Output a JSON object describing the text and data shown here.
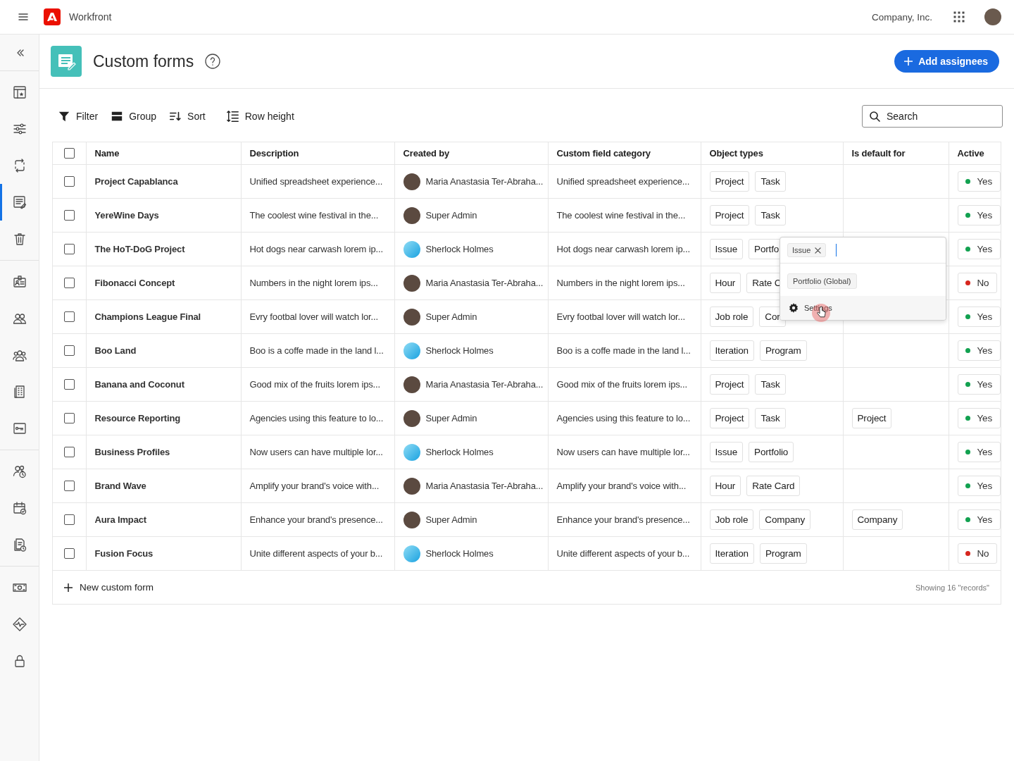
{
  "topbar": {
    "app_name": "Workfront",
    "company": "Company, Inc."
  },
  "sidebar": {
    "groups": [
      [
        {
          "kind": "layout",
          "selected": false
        },
        {
          "kind": "sliders",
          "selected": false
        },
        {
          "kind": "swap",
          "selected": false
        },
        {
          "kind": "form",
          "selected": true
        },
        {
          "kind": "trash",
          "selected": false
        }
      ],
      [
        {
          "kind": "badge",
          "selected": false
        },
        {
          "kind": "pair",
          "selected": false
        },
        {
          "kind": "team",
          "selected": false
        },
        {
          "kind": "building",
          "selected": false
        },
        {
          "kind": "key",
          "selected": false
        }
      ],
      [
        {
          "kind": "userclock",
          "selected": false
        },
        {
          "kind": "calendar",
          "selected": false
        },
        {
          "kind": "docclock",
          "selected": false
        }
      ],
      [
        {
          "kind": "money",
          "selected": false
        },
        {
          "kind": "pulse",
          "selected": false
        },
        {
          "kind": "lock",
          "selected": false
        }
      ]
    ]
  },
  "page": {
    "title": "Custom forms",
    "primary_button": "Add assignees"
  },
  "toolbar": {
    "actions": [
      {
        "kind": "filter",
        "label": "Filter"
      },
      {
        "kind": "group",
        "label": "Group"
      },
      {
        "kind": "sort",
        "label": "Sort"
      },
      {
        "kind": "rowheight",
        "label": "Row height"
      }
    ],
    "search": {
      "placeholder": "Search"
    }
  },
  "table": {
    "select_all": {
      "checked": false
    },
    "columns": [
      "Name",
      "Description",
      "Created by",
      "Custom field category",
      "Object types",
      "Is default for",
      "Active"
    ],
    "rows": [
      {
        "checked": false,
        "name": "Project Capablanca",
        "description": "Unified spreadsheet experience...",
        "created_by": {
          "name": "Maria Anastasia Ter-Abraha...",
          "kind": "photo"
        },
        "category": "Unified spreadsheet experience...",
        "object_types": [
          "Project",
          "Task"
        ],
        "default_for": [],
        "active": {
          "label": "Yes",
          "color": "#12a150"
        }
      },
      {
        "checked": false,
        "name": "YereWine Days",
        "description": "The coolest wine festival in the...",
        "created_by": {
          "name": "Super Admin",
          "kind": "photo"
        },
        "category": "The coolest wine festival in the...",
        "object_types": [
          "Project",
          "Task"
        ],
        "default_for": [],
        "active": {
          "label": "Yes",
          "color": "#12a150"
        }
      },
      {
        "checked": false,
        "name": "The HoT-DoG Project",
        "description": "Hot dogs near carwash lorem ip...",
        "created_by": {
          "name": "Sherlock Holmes",
          "kind": "gradient"
        },
        "category": "Hot dogs near carwash lorem ip...",
        "object_types": [
          "Issue",
          "Portfo"
        ],
        "default_for": [],
        "active": {
          "label": "Yes",
          "color": "#12a150"
        }
      },
      {
        "checked": false,
        "name": "Fibonacci Concept",
        "description": "Numbers in the night lorem ips...",
        "created_by": {
          "name": "Maria Anastasia Ter-Abraha...",
          "kind": "photo"
        },
        "category": "Numbers in the night lorem ips...",
        "object_types": [
          "Hour",
          "Rate C"
        ],
        "default_for": [],
        "active": {
          "label": "No",
          "color": "#d7261e"
        }
      },
      {
        "checked": false,
        "name": "Champions League Final",
        "description": "Evry footbal lover will watch lor...",
        "created_by": {
          "name": "Super Admin",
          "kind": "photo"
        },
        "category": "Evry footbal lover will watch lor...",
        "object_types": [
          "Job role",
          "Cor"
        ],
        "default_for": [],
        "active": {
          "label": "Yes",
          "color": "#12a150"
        }
      },
      {
        "checked": false,
        "name": "Boo Land",
        "description": "Boo is a coffe made in the land l...",
        "created_by": {
          "name": "Sherlock Holmes",
          "kind": "gradient"
        },
        "category": "Boo is a coffe made in the land l...",
        "object_types": [
          "Iteration",
          "Program"
        ],
        "default_for": [],
        "active": {
          "label": "Yes",
          "color": "#12a150"
        }
      },
      {
        "checked": false,
        "name": "Banana and Coconut",
        "description": "Good mix of the fruits lorem ips...",
        "created_by": {
          "name": "Maria Anastasia Ter-Abraha...",
          "kind": "photo"
        },
        "category": "Good mix of the fruits lorem ips...",
        "object_types": [
          "Project",
          "Task"
        ],
        "default_for": [],
        "active": {
          "label": "Yes",
          "color": "#12a150"
        }
      },
      {
        "checked": false,
        "name": "Resource Reporting",
        "description": "Agencies using this feature to lo...",
        "created_by": {
          "name": "Super Admin",
          "kind": "photo"
        },
        "category": "Agencies using this feature to lo...",
        "object_types": [
          "Project",
          "Task"
        ],
        "default_for": [
          "Project"
        ],
        "active": {
          "label": "Yes",
          "color": "#12a150"
        }
      },
      {
        "checked": false,
        "name": "Business Profiles",
        "description": "Now users can have multiple lor...",
        "created_by": {
          "name": "Sherlock Holmes",
          "kind": "gradient"
        },
        "category": "Now users can have multiple lor...",
        "object_types": [
          "Issue",
          "Portfolio"
        ],
        "default_for": [],
        "active": {
          "label": "Yes",
          "color": "#12a150"
        }
      },
      {
        "checked": false,
        "name": "Brand Wave",
        "description": "Amplify your brand's voice with...",
        "created_by": {
          "name": "Maria Anastasia Ter-Abraha...",
          "kind": "photo"
        },
        "category": "Amplify your brand's voice with...",
        "object_types": [
          "Hour",
          "Rate Card"
        ],
        "default_for": [],
        "active": {
          "label": "Yes",
          "color": "#12a150"
        }
      },
      {
        "checked": false,
        "name": "Aura Impact",
        "description": "Enhance your brand's presence...",
        "created_by": {
          "name": "Super Admin",
          "kind": "photo"
        },
        "category": "Enhance your brand's presence...",
        "object_types": [
          "Job role",
          "Company"
        ],
        "default_for": [
          "Company"
        ],
        "active": {
          "label": "Yes",
          "color": "#12a150"
        }
      },
      {
        "checked": false,
        "name": "Fusion Focus",
        "description": "Unite different aspects of your b...",
        "created_by": {
          "name": "Sherlock Holmes",
          "kind": "gradient"
        },
        "category": "Unite different aspects of your b...",
        "object_types": [
          "Iteration",
          "Program"
        ],
        "default_for": [],
        "active": {
          "label": "No",
          "color": "#d7261e"
        }
      }
    ],
    "footer": {
      "add_label": "New custom form",
      "count": "Showing 16 \"records\""
    }
  },
  "popover": {
    "chip": "Issue",
    "option": "Portfolio (Global)",
    "action": "Settings"
  }
}
